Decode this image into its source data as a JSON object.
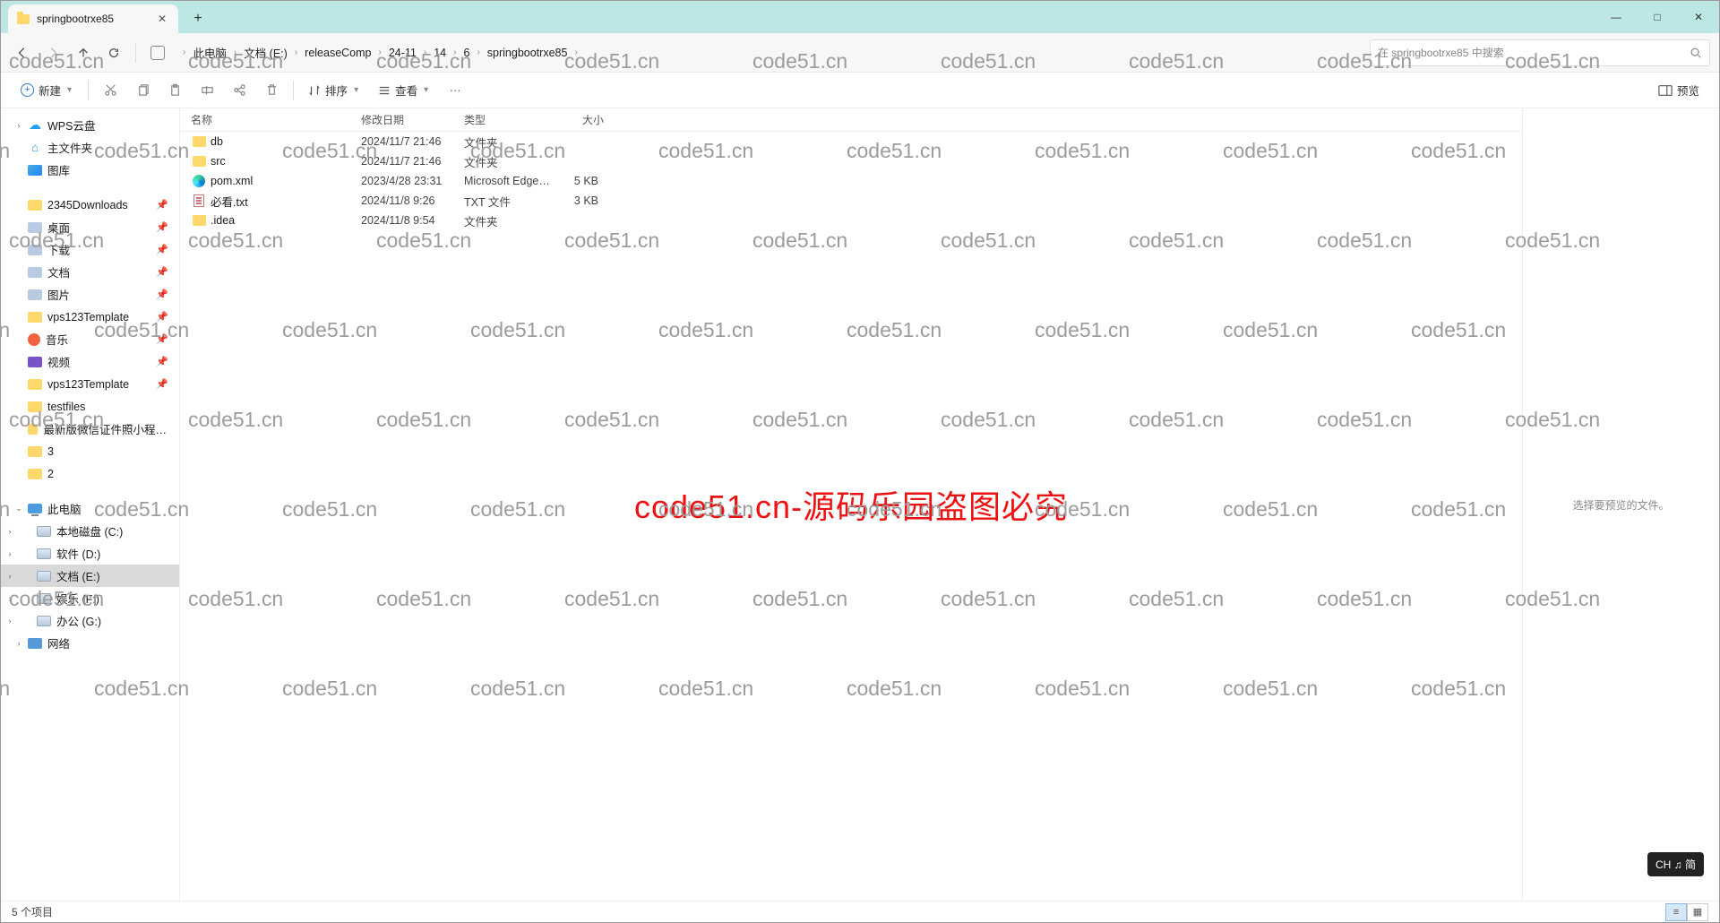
{
  "tab": {
    "title": "springbootrxe85"
  },
  "window_controls": {
    "min": "—",
    "max": "□",
    "close": "✕"
  },
  "breadcrumb": [
    "此电脑",
    "文档 (E:)",
    "releaseComp",
    "24-11",
    "14",
    "6",
    "springbootrxe85"
  ],
  "search": {
    "placeholder": "在 springbootrxe85 中搜索"
  },
  "toolbar": {
    "new": "新建",
    "sort": "排序",
    "view": "查看",
    "preview": "预览"
  },
  "sidebar": {
    "top": [
      {
        "label": "WPS云盘",
        "icon": "cloud"
      },
      {
        "label": "主文件夹",
        "icon": "home"
      },
      {
        "label": "图库",
        "icon": "gallery"
      }
    ],
    "quick": [
      {
        "label": "2345Downloads",
        "icon": "folder",
        "pin": true
      },
      {
        "label": "桌面",
        "icon": "files",
        "pin": true
      },
      {
        "label": "下载",
        "icon": "files",
        "pin": true
      },
      {
        "label": "文档",
        "icon": "files",
        "pin": true
      },
      {
        "label": "图片",
        "icon": "files",
        "pin": true
      },
      {
        "label": "vps123Template",
        "icon": "folder",
        "pin": true
      },
      {
        "label": "音乐",
        "icon": "music",
        "pin": true
      },
      {
        "label": "视频",
        "icon": "video",
        "pin": true
      },
      {
        "label": "vps123Template",
        "icon": "folder",
        "pin": true
      },
      {
        "label": "testfiles",
        "icon": "folder"
      },
      {
        "label": "最新版微信证件照小程序源码 带后台",
        "icon": "folder"
      },
      {
        "label": "3",
        "icon": "folder"
      },
      {
        "label": "2",
        "icon": "folder"
      }
    ],
    "thispc": {
      "label": "此电脑"
    },
    "drives": [
      {
        "label": "本地磁盘 (C:)"
      },
      {
        "label": "软件 (D:)"
      },
      {
        "label": "文档 (E:)",
        "selected": true
      },
      {
        "label": "娱乐 (F:)"
      },
      {
        "label": "办公 (G:)"
      }
    ],
    "network": {
      "label": "网络"
    }
  },
  "columns": {
    "name": "名称",
    "date": "修改日期",
    "type": "类型",
    "size": "大小"
  },
  "files": [
    {
      "name": "db",
      "date": "2024/11/7 21:46",
      "type": "文件夹",
      "size": "",
      "icon": "folder"
    },
    {
      "name": "src",
      "date": "2024/11/7 21:46",
      "type": "文件夹",
      "size": "",
      "icon": "folder"
    },
    {
      "name": "pom.xml",
      "date": "2023/4/28 23:31",
      "type": "Microsoft Edge ...",
      "size": "5 KB",
      "icon": "edge"
    },
    {
      "name": "必看.txt",
      "date": "2024/11/8 9:26",
      "type": "TXT 文件",
      "size": "3 KB",
      "icon": "txt"
    },
    {
      "name": ".idea",
      "date": "2024/11/8 9:54",
      "type": "文件夹",
      "size": "",
      "icon": "folder"
    }
  ],
  "preview": {
    "empty": "选择要预览的文件。"
  },
  "status": {
    "count": "5 个项目"
  },
  "watermark": {
    "cell": "code51.cn",
    "center": "code51.cn-源码乐园盗图必究"
  },
  "ime": {
    "text": "CH ♫ 简"
  }
}
